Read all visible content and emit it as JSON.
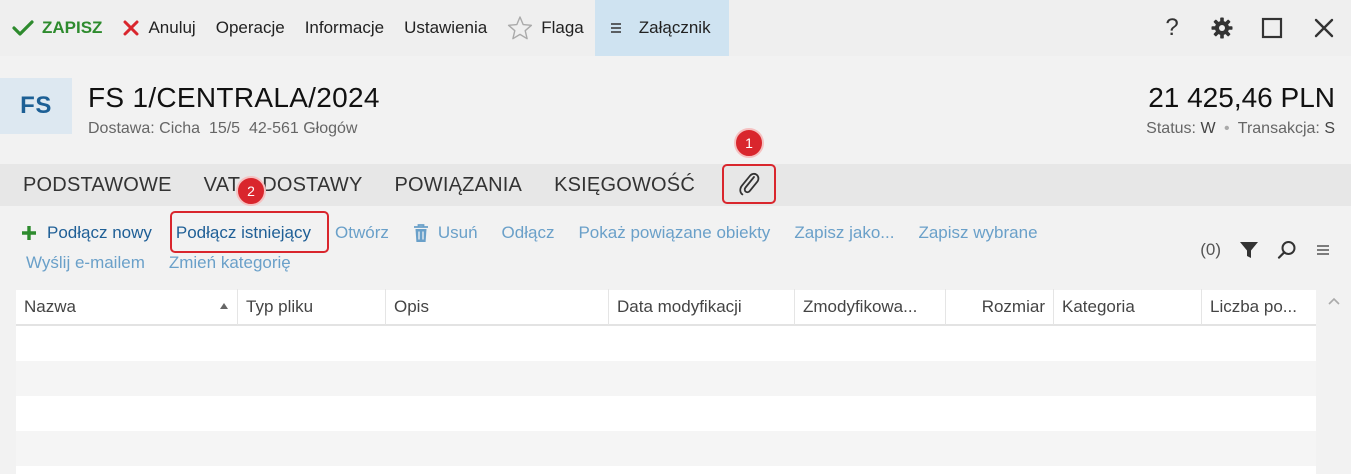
{
  "toolbar": {
    "save_label": "ZAPISZ",
    "cancel_label": "Anuluj",
    "operations_label": "Operacje",
    "info_label": "Informacje",
    "settings_label": "Ustawienia",
    "flag_label": "Flaga",
    "attachment_label": "Załącznik",
    "help_label": "?"
  },
  "header": {
    "badge": "FS",
    "title": "FS 1/CENTRALA/2024",
    "subtitle": "Dostawa: Cicha  15/5  42-561 Głogów",
    "amount": "21 425,46 PLN",
    "status_label": "Status:",
    "status_value": "W",
    "transaction_label": "Transakcja:",
    "transaction_value": "S"
  },
  "tabs": [
    "PODSTAWOWE",
    "VAT",
    "DOSTAWY",
    "POWIĄZANIA",
    "KSIĘGOWOŚĆ"
  ],
  "actions": {
    "attach_new": "Podłącz nowy",
    "attach_existing": "Podłącz istniejący",
    "open": "Otwórz",
    "delete": "Usuń",
    "detach": "Odłącz",
    "show_related": "Pokaż powiązane obiekty",
    "save_as": "Zapisz jako...",
    "save_selected": "Zapisz wybrane",
    "send_email": "Wyślij e-mailem",
    "change_category": "Zmień kategorię",
    "count": "(0)"
  },
  "markers": [
    "1",
    "2"
  ],
  "table": {
    "columns": [
      "Nazwa",
      "Typ pliku",
      "Opis",
      "Data modyfikacji",
      "Zmodyfikowa...",
      "Rozmiar",
      "Kategoria",
      "Liczba po..."
    ]
  },
  "colors": {
    "save_green": "#2e8b2e",
    "cancel_red": "#d9262d",
    "link_blue": "#1f5f96",
    "muted_blue": "#6aa0c9",
    "attachment_tab_bg": "#cfe3f1",
    "highlight_red": "#d9262d"
  }
}
